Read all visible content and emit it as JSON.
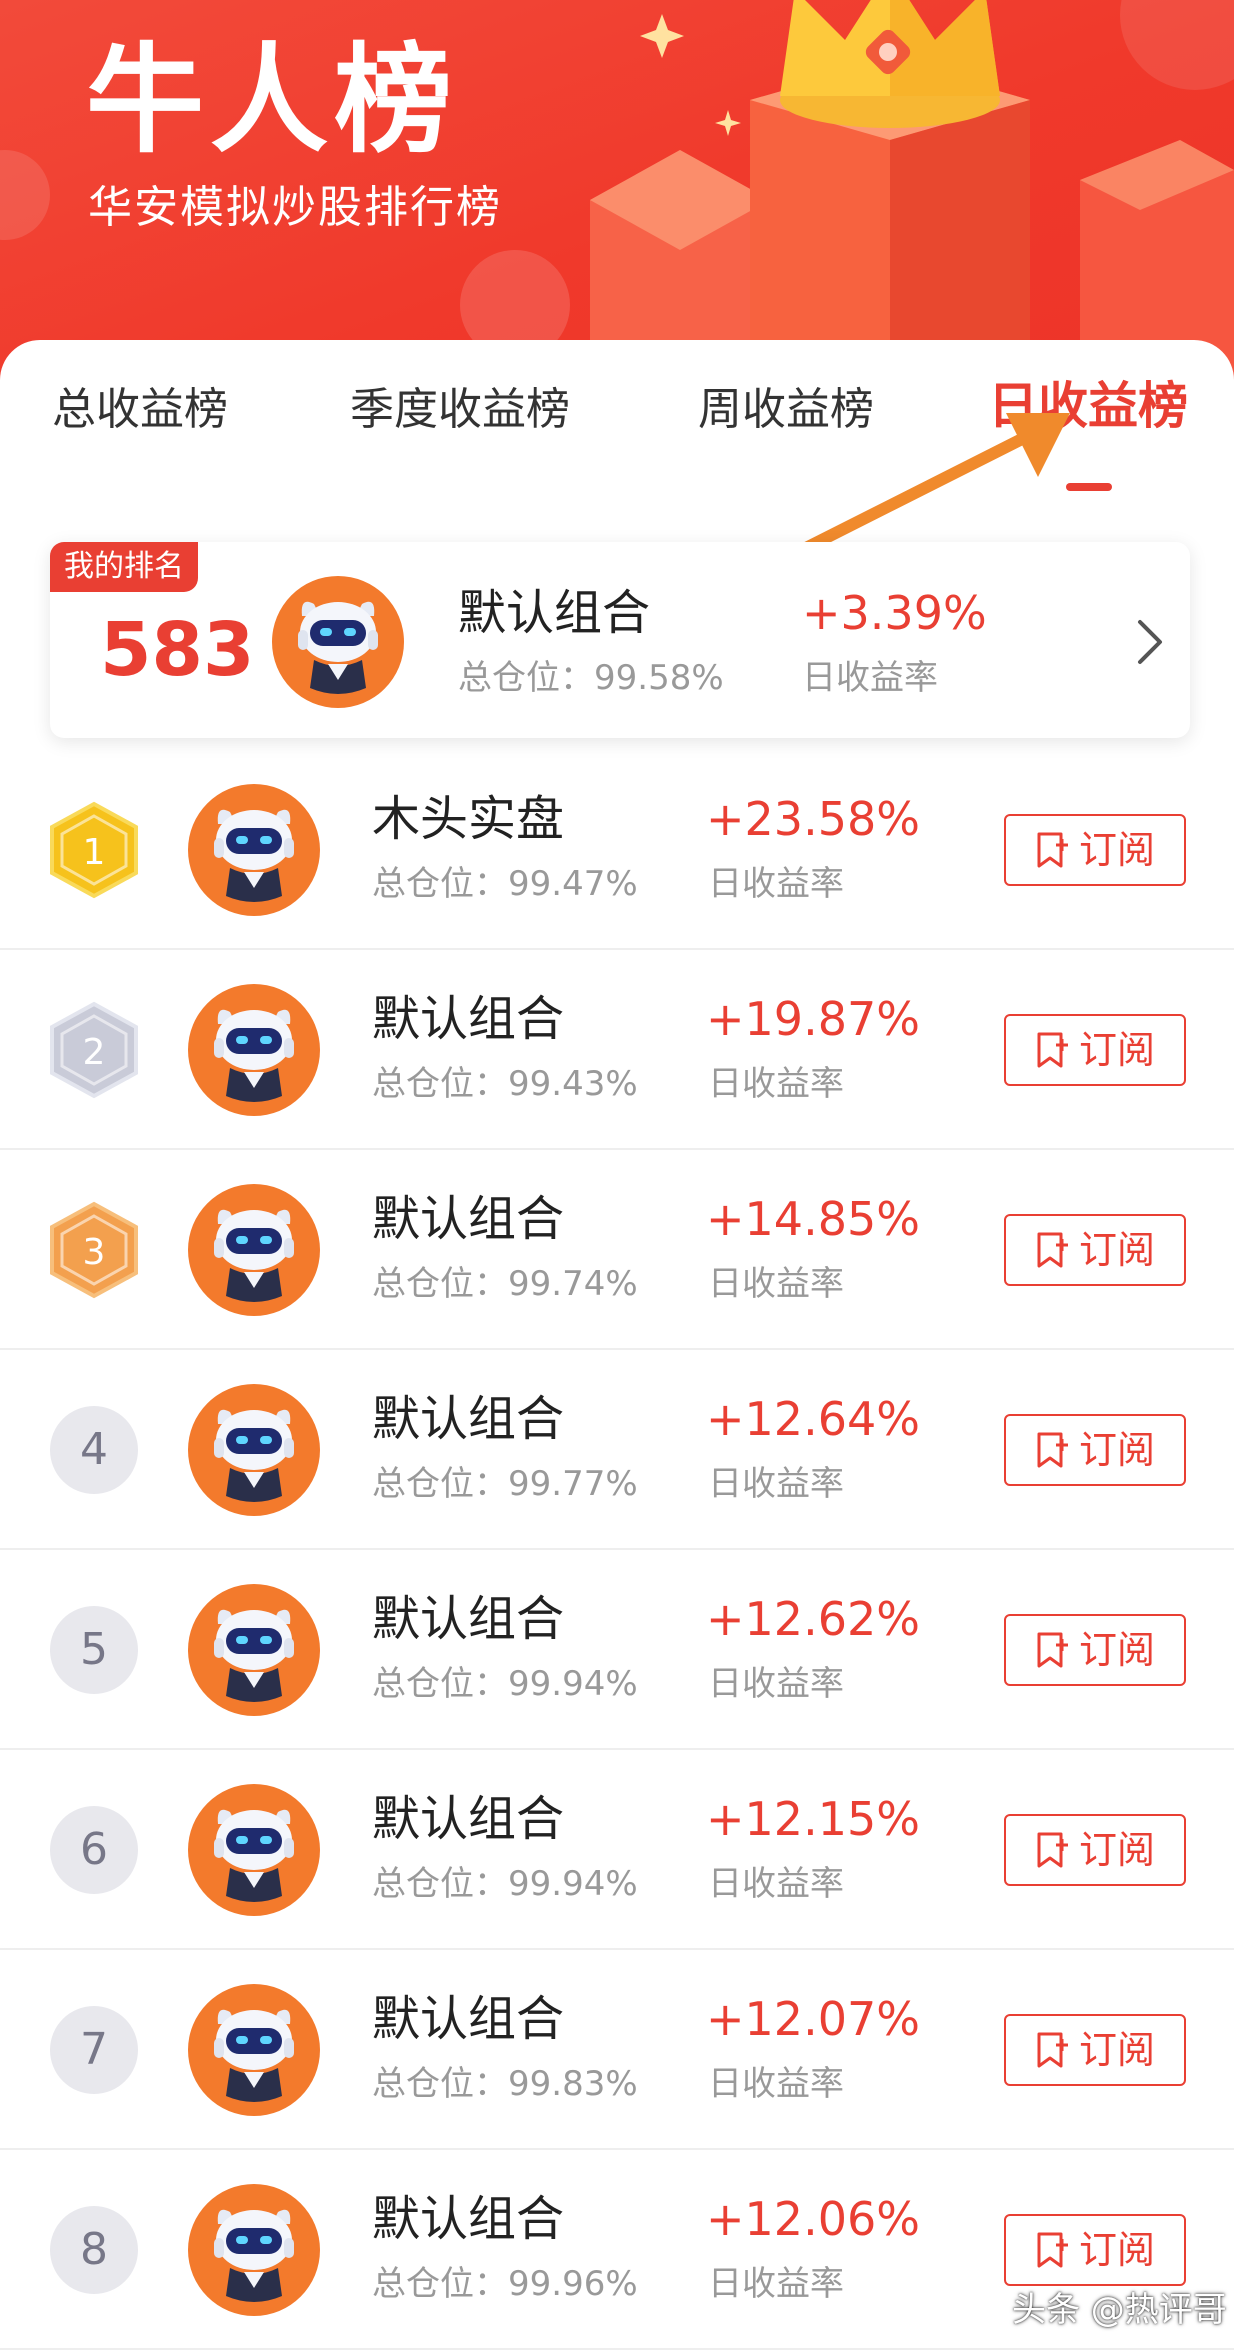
{
  "header": {
    "title": "牛人榜",
    "subtitle": "华安模拟炒股排行榜"
  },
  "tabs": [
    {
      "label": "总收益榜",
      "active": false
    },
    {
      "label": "季度收益榜",
      "active": false
    },
    {
      "label": "周收益榜",
      "active": false
    },
    {
      "label": "日收益榜",
      "active": true
    }
  ],
  "my_rank": {
    "badge": "我的排名",
    "rank": "583",
    "name": "默认组合",
    "position": "总仓位：99.58%",
    "rate": "+3.39%",
    "rate_label": "日收益率"
  },
  "list": [
    {
      "rank": "1",
      "medal": "gold",
      "name": "木头实盘",
      "position": "总仓位：99.47%",
      "rate": "+23.58%",
      "rate_label": "日收益率",
      "subscribe": "订阅"
    },
    {
      "rank": "2",
      "medal": "silver",
      "name": "默认组合",
      "position": "总仓位：99.43%",
      "rate": "+19.87%",
      "rate_label": "日收益率",
      "subscribe": "订阅"
    },
    {
      "rank": "3",
      "medal": "bronze",
      "name": "默认组合",
      "position": "总仓位：99.74%",
      "rate": "+14.85%",
      "rate_label": "日收益率",
      "subscribe": "订阅"
    },
    {
      "rank": "4",
      "medal": "none",
      "name": "默认组合",
      "position": "总仓位：99.77%",
      "rate": "+12.64%",
      "rate_label": "日收益率",
      "subscribe": "订阅"
    },
    {
      "rank": "5",
      "medal": "none",
      "name": "默认组合",
      "position": "总仓位：99.94%",
      "rate": "+12.62%",
      "rate_label": "日收益率",
      "subscribe": "订阅"
    },
    {
      "rank": "6",
      "medal": "none",
      "name": "默认组合",
      "position": "总仓位：99.94%",
      "rate": "+12.15%",
      "rate_label": "日收益率",
      "subscribe": "订阅"
    },
    {
      "rank": "7",
      "medal": "none",
      "name": "默认组合",
      "position": "总仓位：99.83%",
      "rate": "+12.07%",
      "rate_label": "日收益率",
      "subscribe": "订阅"
    },
    {
      "rank": "8",
      "medal": "none",
      "name": "默认组合",
      "position": "总仓位：99.96%",
      "rate": "+12.06%",
      "rate_label": "日收益率",
      "subscribe": "订阅"
    }
  ],
  "watermark": "头条 @热评哥",
  "colors": {
    "accent": "#e93f33",
    "header_bg": "#f0392b",
    "avatar_bg": "#f37a2c",
    "gold": "#f6c21c",
    "silver": "#c9cbd8",
    "bronze": "#f3a04e",
    "arrow": "#f08a2c"
  },
  "icons": {
    "avatar": "robot-avatar-icon",
    "subscribe": "bookmark-plus-icon",
    "chevron": "chevron-right-icon",
    "crown": "crown-icon",
    "medal": "hexagon-medal-icon"
  }
}
